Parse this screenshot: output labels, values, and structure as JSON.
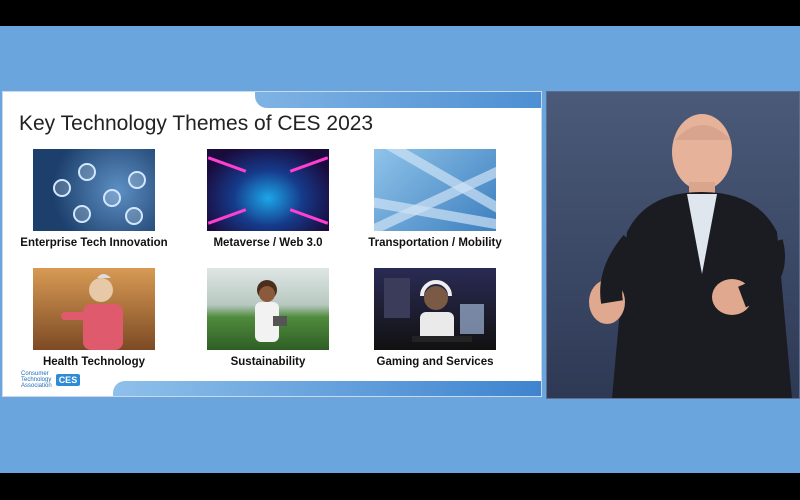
{
  "slide": {
    "title": "Key Technology Themes of CES 2023",
    "themes": [
      {
        "caption": "Enterprise Tech Innovation"
      },
      {
        "caption": "Metaverse / Web 3.0"
      },
      {
        "caption": "Transportation / Mobility"
      },
      {
        "caption": "Health Technology"
      },
      {
        "caption": "Sustainability"
      },
      {
        "caption": "Gaming and Services"
      }
    ],
    "logo": {
      "org_line1": "Consumer",
      "org_line2": "Technology",
      "org_line3": "Association",
      "ces": "CES"
    }
  },
  "colors": {
    "stage_bg": "#6aa5dd",
    "band_blue": "#4d8fd3"
  }
}
